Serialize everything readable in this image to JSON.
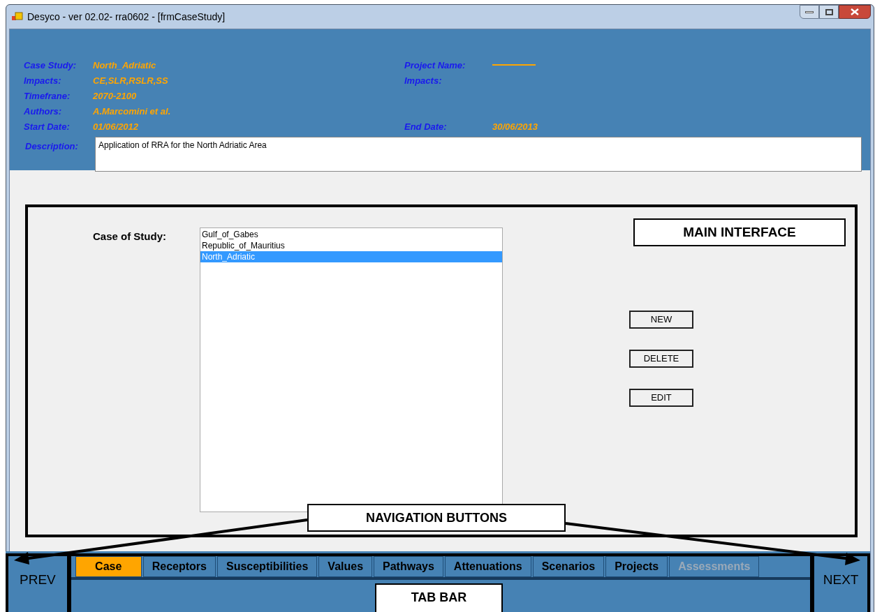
{
  "window": {
    "title": "Desyco - ver 02.02- rra0602 - [frmCaseStudy]"
  },
  "header": {
    "rows": [
      {
        "left": {
          "label": "Case Study:",
          "value": "North_Adriatic"
        },
        "right": {
          "label": "Project Name:",
          "kind": "line"
        }
      },
      {
        "left": {
          "label": "Impacts:",
          "value": "CE,SLR,RSLR,SS"
        },
        "right": {
          "label": "Impacts:",
          "kind": "empty"
        }
      },
      {
        "left": {
          "label": "Timefrane:",
          "value": "2070-2100"
        }
      },
      {
        "left": {
          "label": "Authors:",
          "value": "A.Marcomini et al."
        }
      },
      {
        "left": {
          "label": "Start Date:",
          "value": "01/06/2012"
        },
        "right": {
          "label": "End Date:",
          "value": "30/06/2013",
          "kind": "text"
        }
      }
    ],
    "description": {
      "label": "Description:",
      "value": "Application of RRA for the North Adriatic Area"
    }
  },
  "main": {
    "label": "Case of Study:",
    "cases": [
      {
        "label": "Gulf_of_Gabes",
        "selected": false
      },
      {
        "label": "Republic_of_Mauritius",
        "selected": false
      },
      {
        "label": "North_Adriatic",
        "selected": true
      }
    ],
    "buttons": [
      "NEW",
      "DELETE",
      "EDIT"
    ]
  },
  "navigation": {
    "prev": "PREV",
    "next": "NEXT"
  },
  "tabs": [
    {
      "label": "Case",
      "selected": true,
      "disabled": false
    },
    {
      "label": "Receptors",
      "selected": false,
      "disabled": false
    },
    {
      "label": "Susceptibilities",
      "selected": false,
      "disabled": false
    },
    {
      "label": "Values",
      "selected": false,
      "disabled": false
    },
    {
      "label": "Pathways",
      "selected": false,
      "disabled": false
    },
    {
      "label": "Attenuations",
      "selected": false,
      "disabled": false
    },
    {
      "label": "Scenarios",
      "selected": false,
      "disabled": false
    },
    {
      "label": "Projects",
      "selected": false,
      "disabled": false
    },
    {
      "label": "Assessments",
      "selected": false,
      "disabled": true
    }
  ],
  "callouts": {
    "main_interface": "MAIN INTERFACE",
    "navigation_buttons": "NAVIGATION BUTTONS",
    "tab_bar": "TAB BAR"
  }
}
